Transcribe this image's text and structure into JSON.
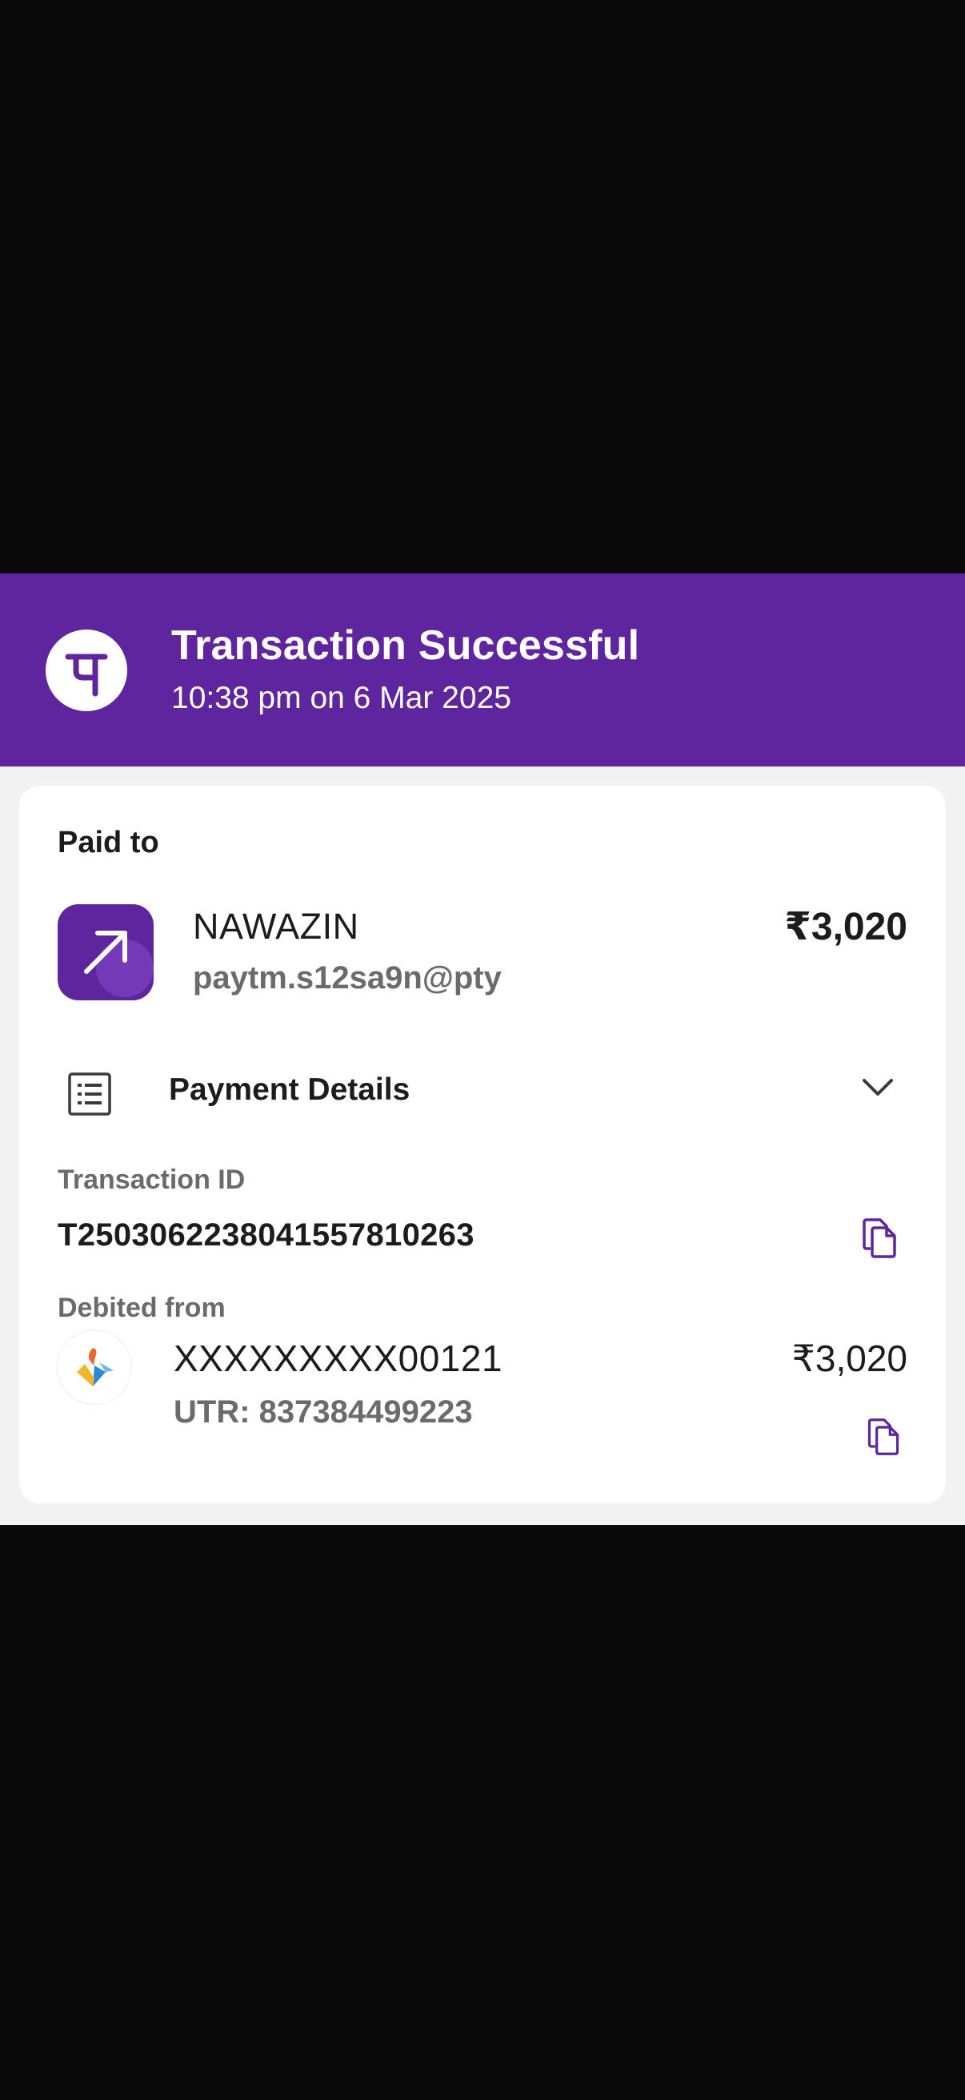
{
  "colors": {
    "brand": "#5f259f",
    "backdrop": "#0a0a0b",
    "sheet": "#f2f2f3",
    "card": "#ffffff",
    "text_primary": "#1c1c1c",
    "text_secondary": "#6b6b6b"
  },
  "header": {
    "logo_icon": "phonepe-logo-icon",
    "title": "Transaction Successful",
    "subtitle": "10:38 pm on 6 Mar 2025"
  },
  "paid_to": {
    "label": "Paid to",
    "icon": "arrow-up-right-icon",
    "name": "NAWAZIN",
    "upi_id": "paytm.s12sa9n@pty",
    "amount": "₹3,020"
  },
  "payment_details": {
    "icon": "receipt-icon",
    "label": "Payment Details",
    "chevron": "chevron-down-icon",
    "transaction_id_label": "Transaction ID",
    "transaction_id": "T2503062238041557810263",
    "copy_icon": "copy-icon",
    "debited_from_label": "Debited from",
    "bank_icon": "bank-logo-icon",
    "account": "XXXXXXXXX00121",
    "utr": "UTR: 837384499223",
    "amount": "₹3,020"
  }
}
